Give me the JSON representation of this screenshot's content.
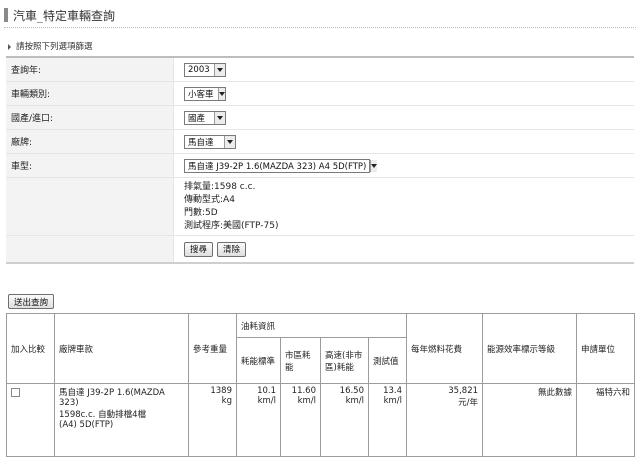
{
  "page_title": "汽車_特定車輛查詢",
  "instruction": "請按照下列選項篩選",
  "form": {
    "year": {
      "label": "查詢年:",
      "value": "2003"
    },
    "category": {
      "label": "車輛類別:",
      "value": "小客車"
    },
    "origin": {
      "label": "國產/進口:",
      "value": "國產"
    },
    "brand": {
      "label": "廠牌:",
      "value": "馬自達"
    },
    "model": {
      "label": "車型:",
      "value": "馬自達 J39-2P 1.6(MAZDA 323) A4 5D(FTP)"
    },
    "info": {
      "displacement": "排氣量:1598 c.c.",
      "transmission": "傳動型式:A4",
      "doors": "門數:5D",
      "test": "測試程序:美國(FTP-75)"
    },
    "search_label": "搜尋",
    "clear_label": "清除"
  },
  "send_label": "送出查詢",
  "results": {
    "headers": {
      "add": "加入比較",
      "model": "廠牌車款",
      "weight": "參考重量",
      "fuel_group": "油耗資訊",
      "standard": "耗能標準",
      "city": "市區耗能",
      "highway": "高速(非市區)耗能",
      "test": "測試值",
      "annual": "每年燃料花費",
      "grade": "能源效率標示等級",
      "applicant": "申請單位"
    },
    "rows": [
      {
        "model_line1": "馬自達 J39-2P 1.6(MAZDA 323)",
        "model_line2": "1598c.c. 自動排檔4檔",
        "model_line3": "(A4) 5D(FTP)",
        "weight_value": "1389",
        "weight_unit": "kg",
        "standard_value": "10.1",
        "city_value": "11.60",
        "highway_value": "16.50",
        "test_value": "13.4",
        "fuel_unit": "km/l",
        "annual_value": "35,821",
        "annual_unit": "元/年",
        "grade": "無此數據",
        "applicant": "福特六和"
      }
    ]
  }
}
